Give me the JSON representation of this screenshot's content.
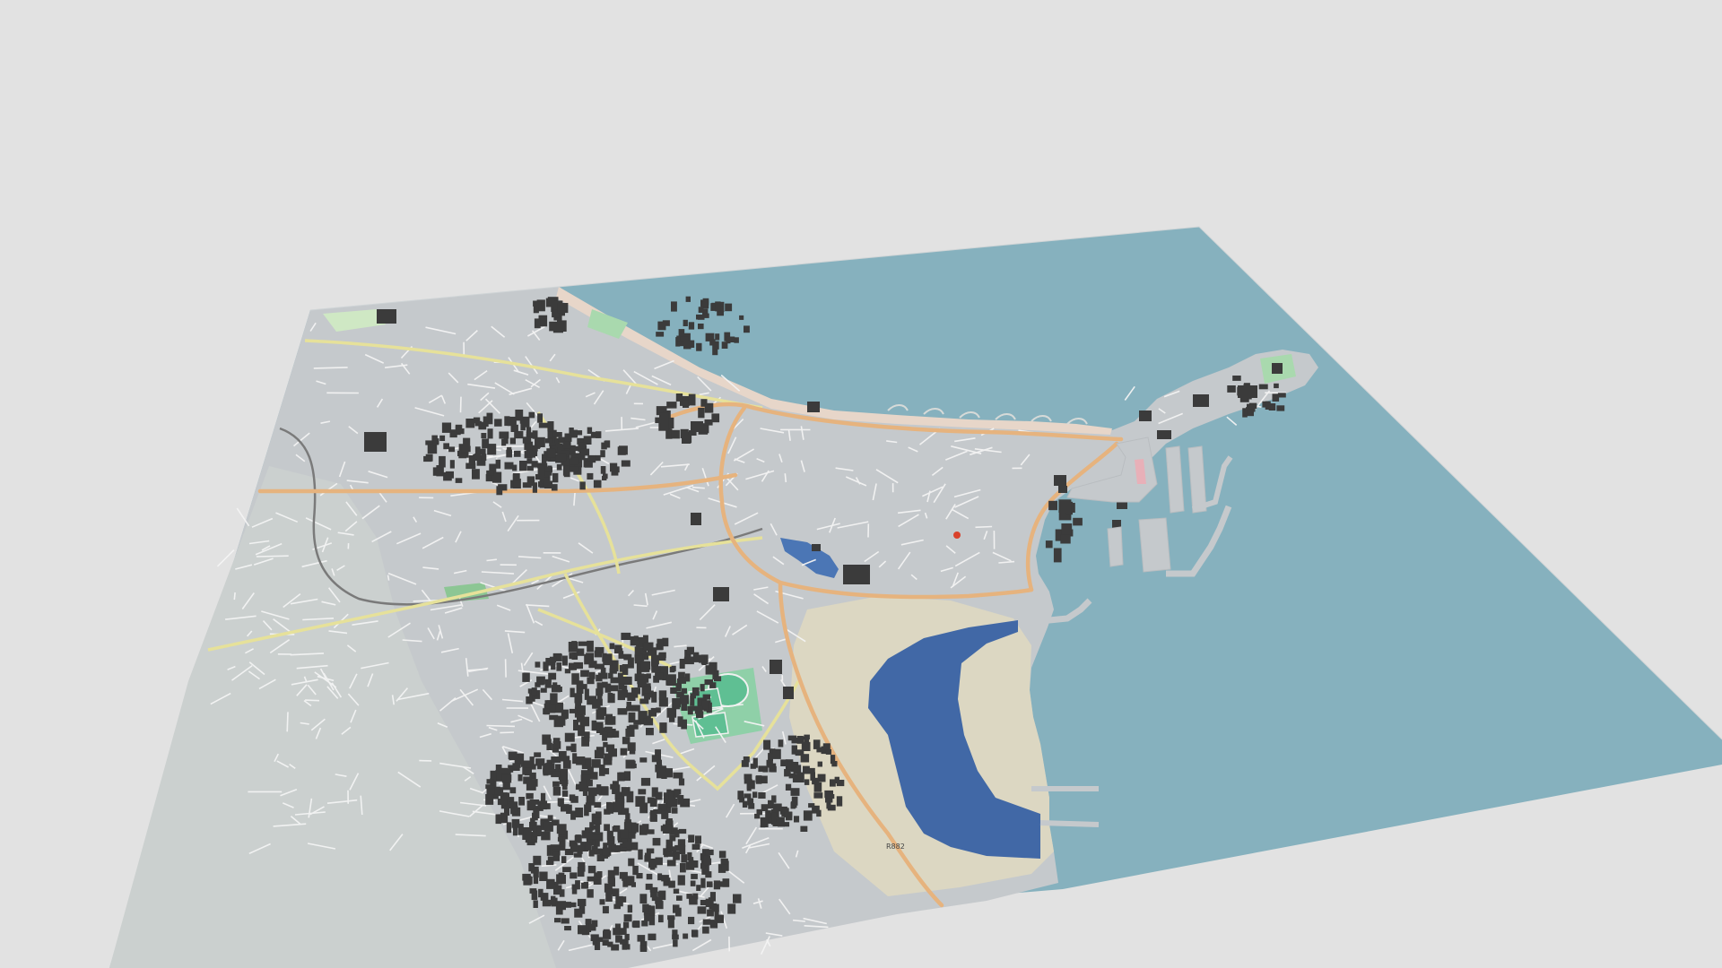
{
  "scene": {
    "description_type": "3d-map-model-viewer",
    "background_color": "#e2e2e2",
    "sea_color": "#86b1be",
    "land_color": "#c5c9cc",
    "land_light_color": "#d6dad8",
    "beach_color": "#dcd7c2",
    "lake_color": "#4168a6",
    "park_color": "#9ccfa6",
    "sports_color": "#5fbf93",
    "road_major_color": "#e6b37e",
    "road_secondary_color": "#e6e19a",
    "road_minor_color": "#f4f4f4",
    "building_color": "#3b3b3b",
    "railway_color": "#7a7a7a"
  },
  "labels": {
    "road_ref_1": "R882",
    "road_ref_2": "R882",
    "road_ref_3": "R882"
  }
}
